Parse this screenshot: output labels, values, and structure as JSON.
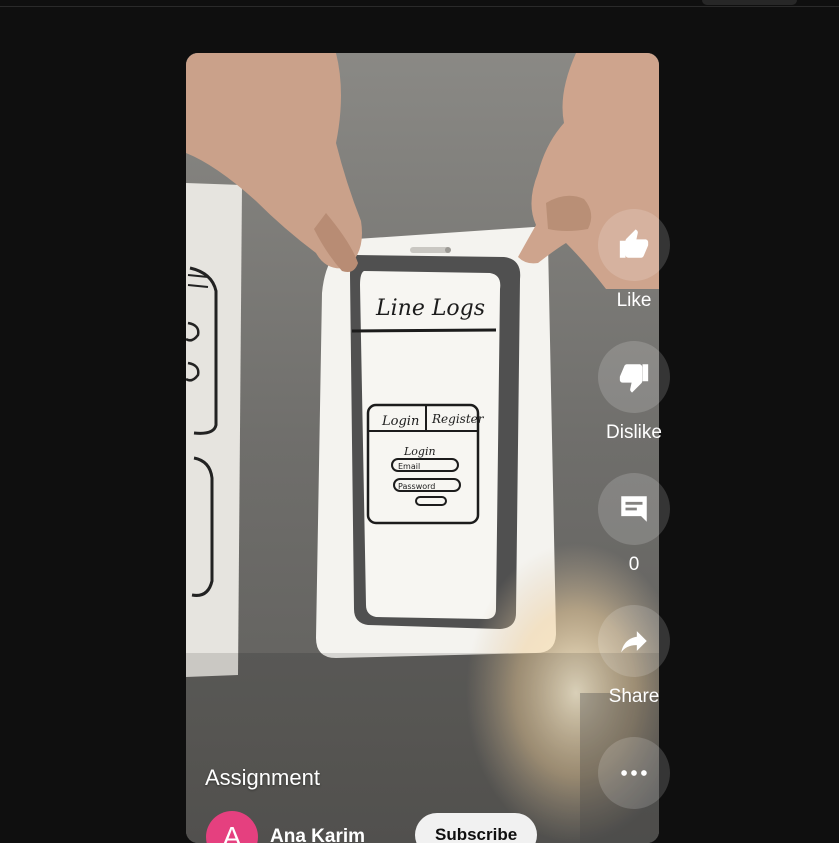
{
  "short": {
    "title": "Assignment",
    "channel_initial": "A",
    "channel_name": "Ana Karim",
    "subscribe_label": "Subscribe"
  },
  "video": {
    "drawing_title": "Line Logs",
    "tab_login": "Login",
    "tab_register": "Register",
    "form_heading": "Login",
    "field_email": "Email",
    "field_password": "Password"
  },
  "actions": {
    "like_label": "Like",
    "dislike_label": "Dislike",
    "comments_count": "0",
    "share_label": "Share"
  },
  "icons": [
    "thumbs-up-icon",
    "thumbs-down-icon",
    "comment-icon",
    "share-icon",
    "more-icon"
  ]
}
